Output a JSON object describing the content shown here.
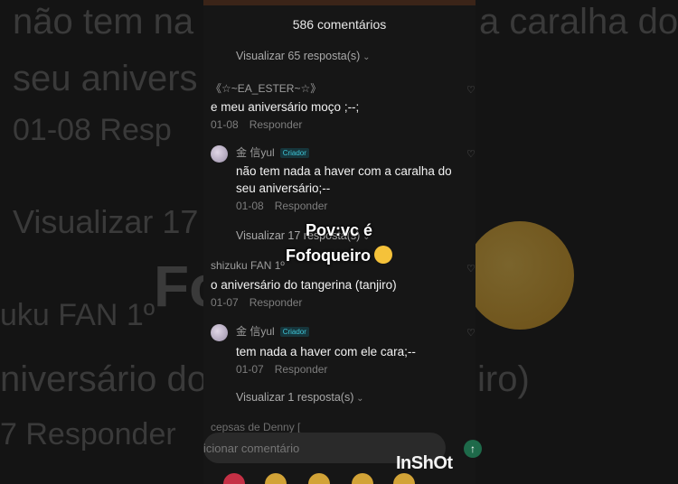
{
  "background": {
    "lines": [
      "não tem na",
      "a caralha do",
      "seu anivers",
      "01-08   Resp",
      "Visualizar 17",
      "Fo",
      "uku FAN 1º",
      "niversário do",
      "iro)",
      "7   Responder"
    ]
  },
  "header": {
    "title": "586 comentários"
  },
  "replies_links": [
    "Visualizar 65 resposta(s)",
    "Visualizar 17 resposta(s)",
    "Visualizar 1 resposta(s)"
  ],
  "comments": [
    {
      "username": "《☆~EA_ESTER~☆》",
      "text": "e meu aniversário moço ;--;",
      "date": "01-08",
      "reply": "Responder"
    },
    {
      "username": "金 信yul",
      "badge": "Criador",
      "text": "não tem nada a haver com a caralha do seu aniversário;--",
      "date": "01-08",
      "reply": "Responder"
    },
    {
      "username": "shizuku FAN 1º",
      "text": "o aniversário do tangerina (tanjiro)",
      "date": "01-07",
      "reply": "Responder"
    },
    {
      "username": "金 信yul",
      "badge": "Criador",
      "text": "tem nada a haver com ele cara;--",
      "date": "01-07",
      "reply": "Responder"
    }
  ],
  "partial_username": "cepsas de Denny [",
  "input": {
    "placeholder": "icionar comentário"
  },
  "overlay": {
    "line1": "Pov:vc é",
    "line2": "Fofoqueiro"
  },
  "watermark": "InShOt",
  "colors": {
    "badge": "#3fc6d8",
    "smile": "#f5c23a"
  }
}
